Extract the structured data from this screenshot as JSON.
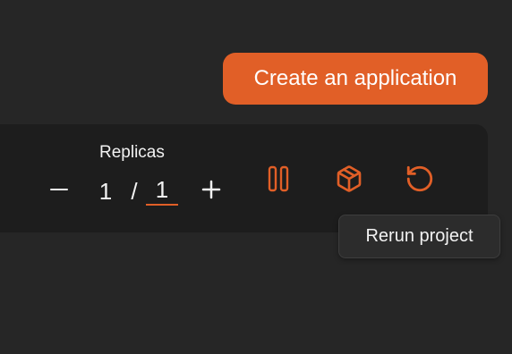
{
  "header": {
    "create_button_label": "Create an application"
  },
  "replicas": {
    "label": "Replicas",
    "current": "1",
    "separator": "/",
    "target": "1"
  },
  "controls": {
    "decrement_icon": "minus-icon",
    "increment_icon": "plus-icon",
    "pause_icon": "pause-icon",
    "package_icon": "package-icon",
    "rerun_icon": "rotate-ccw-icon"
  },
  "tooltip": {
    "text": "Rerun project"
  },
  "colors": {
    "accent": "#e15f27",
    "background": "#262626",
    "panel": "#1d1d1d",
    "tooltip_bg": "#2c2c2c",
    "text": "#f2f2f2"
  }
}
